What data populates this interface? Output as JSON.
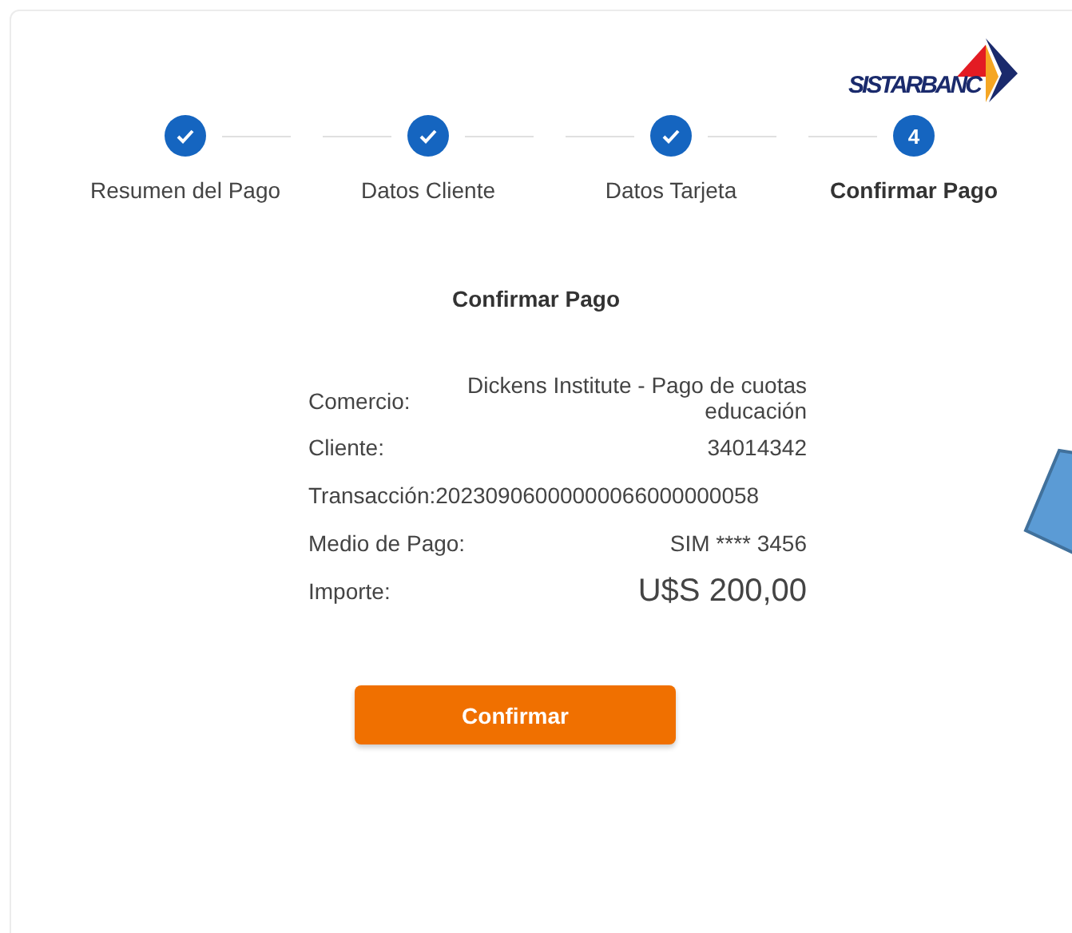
{
  "logo": {
    "text": "SISTARBANC"
  },
  "steps": [
    {
      "label": "Resumen del Pago",
      "done": true,
      "selected": false
    },
    {
      "label": "Datos Cliente",
      "done": true,
      "selected": false
    },
    {
      "label": "Datos Tarjeta",
      "done": true,
      "selected": false
    },
    {
      "label": "Confirmar Pago",
      "number": "4",
      "done": false,
      "selected": true
    }
  ],
  "title": "Confirmar Pago",
  "details": [
    {
      "kind": "split",
      "label": "Comercio:",
      "value": "Dickens Institute - Pago de cuotas educación"
    },
    {
      "kind": "split",
      "label": "Cliente:",
      "value": "34014342"
    },
    {
      "kind": "inline",
      "label": "Transacción:",
      "value": "20230906000000066000000058"
    },
    {
      "kind": "split",
      "label": "Medio de Pago:",
      "value": "SIM **** 3456"
    },
    {
      "kind": "amount",
      "label": "Importe:",
      "value": "U$S 200,00"
    }
  ],
  "button": "Confirmar"
}
